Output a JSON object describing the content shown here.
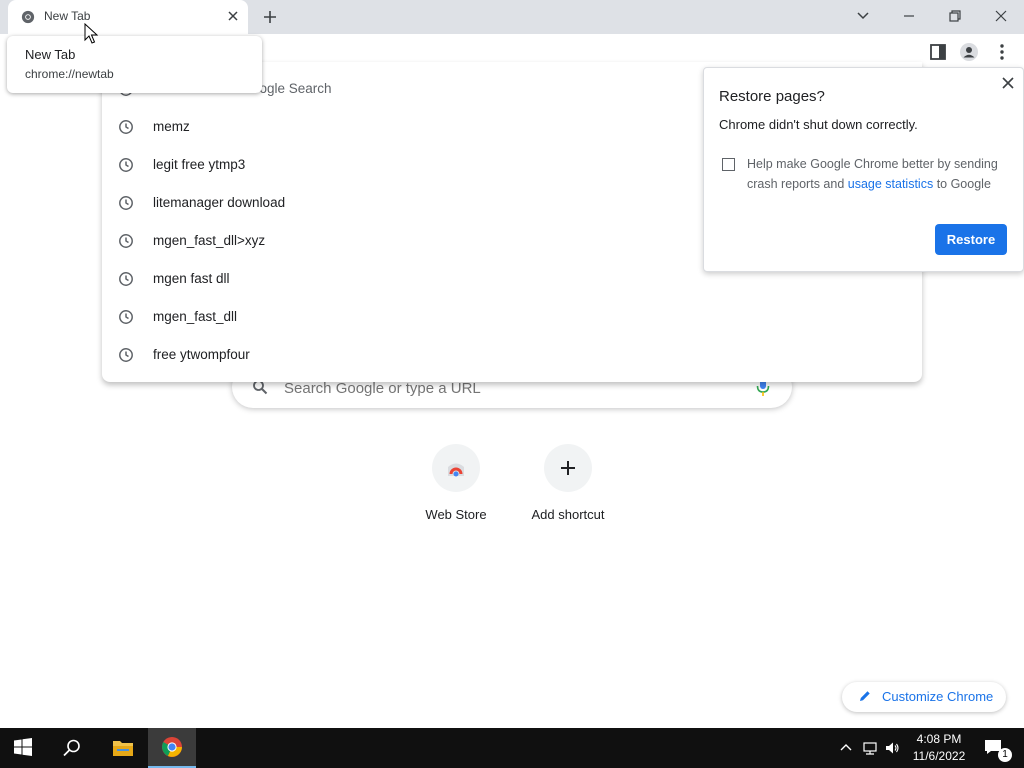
{
  "tab": {
    "title": "New Tab"
  },
  "hover_card": {
    "title": "New Tab",
    "url": "chrome://newtab"
  },
  "omnibox": {
    "first_suggestion": "oogle Search",
    "suggestions": [
      "memz",
      "legit free ytmp3",
      "litemanager download",
      "mgen_fast_dll>xyz",
      "mgen fast dll",
      "mgen_fast_dll",
      "free ytwompfour"
    ]
  },
  "search": {
    "placeholder": "Search Google or type a URL"
  },
  "shortcuts": [
    {
      "label": "Web Store"
    },
    {
      "label": "Add shortcut"
    }
  ],
  "restore_bubble": {
    "title": "Restore pages?",
    "body": "Chrome didn't shut down correctly.",
    "checkbox_line1": "Help make Google Chrome better by sending",
    "checkbox_line2_prefix": "crash reports and ",
    "link": "usage statistics",
    "checkbox_line2_suffix": " to Google",
    "button": "Restore"
  },
  "customize": {
    "label": "Customize Chrome"
  },
  "taskbar": {
    "time": "4:08 PM",
    "date": "11/6/2022",
    "notification_count": "1"
  },
  "colors": {
    "accent": "#1a73e8",
    "titlebar": "#dee1e6",
    "taskbar": "#101010"
  }
}
